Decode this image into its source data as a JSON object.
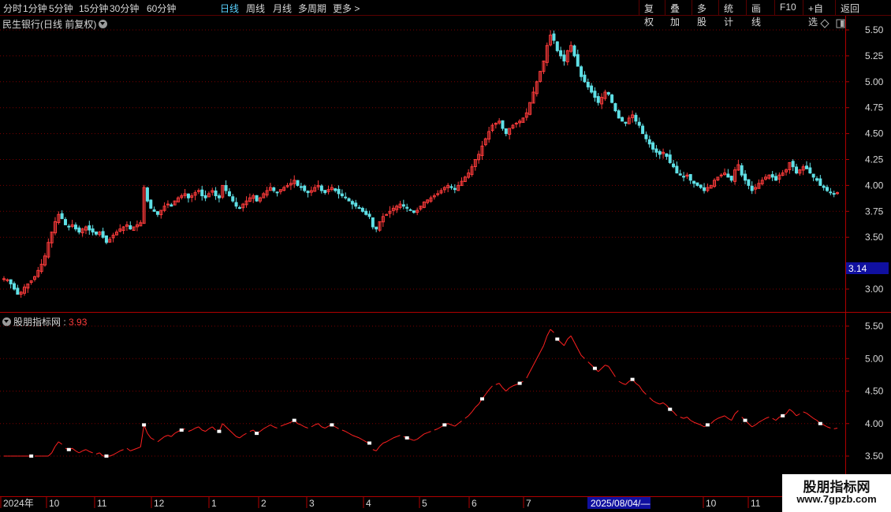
{
  "toolbar": {
    "periods": [
      "分时",
      "1分钟",
      "5分钟",
      "15分钟",
      "30分钟",
      "60分钟",
      "日线",
      "周线",
      "月线",
      "多周期",
      "更多 >"
    ],
    "active_period": "日线",
    "right_buttons": [
      "复权",
      "叠加",
      "多股",
      "统计",
      "画线",
      "F10",
      "+自选",
      "返回"
    ]
  },
  "main_panel": {
    "title": "民生银行(日线 前复权)",
    "price_ticks": [
      "5.50",
      "5.25",
      "5.00",
      "4.75",
      "4.50",
      "4.25",
      "4.00",
      "3.75",
      "3.50",
      "3.00"
    ],
    "highlight_price": "3.14",
    "colors": {
      "up": "#ff3b3b",
      "down": "#5fe0e6",
      "grid": "#7a0000",
      "axis": "#b00000"
    }
  },
  "indicator_panel": {
    "name": "股朋指标网",
    "value": "3.93",
    "ticks": [
      "5.50",
      "5.00",
      "4.50",
      "4.00",
      "3.50"
    ]
  },
  "time_axis": {
    "labels": [
      "2024年",
      "10",
      "11",
      "12",
      "1",
      "2",
      "3",
      "4",
      "5",
      "6",
      "7",
      "10",
      "11"
    ],
    "cursor_date": "2025/08/04/—"
  },
  "watermark": {
    "name": "股朋指标网",
    "url": "www.7gpzb.com"
  },
  "chart_data": {
    "type": "candlestick",
    "title": "民生银行(日线 前复权)",
    "ylim": [
      2.9,
      5.55
    ],
    "approx_close": [
      3.1,
      3.09,
      3.05,
      3.0,
      2.95,
      2.97,
      3.02,
      3.05,
      3.08,
      3.12,
      3.18,
      3.24,
      3.32,
      3.45,
      3.55,
      3.65,
      3.72,
      3.68,
      3.62,
      3.6,
      3.62,
      3.58,
      3.55,
      3.58,
      3.6,
      3.57,
      3.55,
      3.53,
      3.55,
      3.5,
      3.45,
      3.48,
      3.52,
      3.55,
      3.58,
      3.6,
      3.62,
      3.58,
      3.6,
      3.62,
      3.64,
      3.98,
      3.85,
      3.78,
      3.75,
      3.72,
      3.76,
      3.8,
      3.82,
      3.8,
      3.85,
      3.88,
      3.9,
      3.92,
      3.88,
      3.9,
      3.93,
      3.95,
      3.9,
      3.88,
      3.92,
      3.95,
      3.9,
      3.88,
      4.0,
      3.95,
      3.9,
      3.85,
      3.8,
      3.78,
      3.82,
      3.85,
      3.88,
      3.9,
      3.85,
      3.88,
      3.92,
      3.95,
      3.98,
      3.95,
      3.93,
      3.96,
      3.98,
      4.0,
      4.02,
      4.05,
      4.0,
      3.98,
      3.95,
      3.93,
      3.95,
      3.98,
      4.0,
      3.95,
      3.93,
      3.96,
      3.98,
      3.95,
      3.92,
      3.9,
      3.88,
      3.85,
      3.82,
      3.8,
      3.78,
      3.75,
      3.72,
      3.7,
      3.6,
      3.58,
      3.65,
      3.7,
      3.72,
      3.75,
      3.78,
      3.8,
      3.82,
      3.8,
      3.78,
      3.76,
      3.74,
      3.76,
      3.8,
      3.84,
      3.86,
      3.88,
      3.9,
      3.92,
      3.95,
      3.98,
      4.0,
      3.98,
      3.96,
      4.0,
      4.04,
      4.08,
      4.12,
      4.18,
      4.25,
      4.3,
      4.38,
      4.45,
      4.52,
      4.58,
      4.6,
      4.62,
      4.55,
      4.5,
      4.55,
      4.58,
      4.6,
      4.62,
      4.65,
      4.7,
      4.8,
      4.9,
      5.0,
      5.1,
      5.2,
      5.35,
      5.45,
      5.4,
      5.3,
      5.25,
      5.2,
      5.3,
      5.35,
      5.25,
      5.15,
      5.05,
      5.0,
      4.95,
      4.9,
      4.85,
      4.8,
      4.85,
      4.9,
      4.88,
      4.8,
      4.72,
      4.65,
      4.62,
      4.6,
      4.65,
      4.68,
      4.62,
      4.58,
      4.5,
      4.45,
      4.4,
      4.35,
      4.32,
      4.3,
      4.32,
      4.28,
      4.22,
      4.18,
      4.12,
      4.1,
      4.08,
      4.1,
      4.05,
      4.02,
      4.0,
      3.98,
      3.95,
      3.98,
      4.0,
      4.05,
      4.08,
      4.1,
      4.12,
      4.08,
      4.05,
      4.15,
      4.2,
      4.1,
      4.05,
      4.0,
      3.95,
      3.98,
      4.02,
      4.05,
      4.08,
      4.1,
      4.08,
      4.05,
      4.1,
      4.12,
      4.15,
      4.22,
      4.18,
      4.12,
      4.15,
      4.18,
      4.16,
      4.12,
      4.08,
      4.05,
      4.0,
      3.98,
      3.95,
      3.93,
      3.92,
      3.93
    ]
  }
}
